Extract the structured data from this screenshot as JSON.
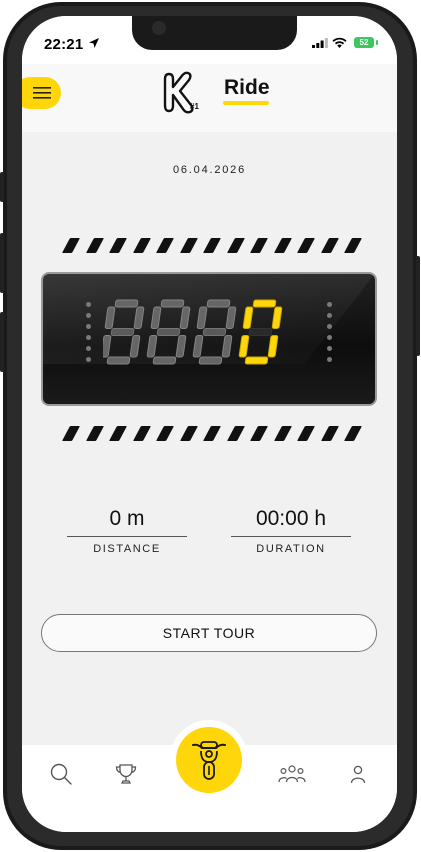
{
  "status_bar": {
    "time": "22:21",
    "battery": "52"
  },
  "header": {
    "title": "Ride"
  },
  "ride": {
    "date": "06.04.2026",
    "odometer_digits": [
      "0",
      "0",
      "0",
      "0"
    ],
    "distance_value": "0 m",
    "distance_label": "DISTANCE",
    "duration_value": "00:00 h",
    "duration_label": "DURATION",
    "start_button": "START TOUR"
  },
  "tabs": [
    "search-icon",
    "trophy-icon",
    "motorcycle-icon",
    "community-icon",
    "profile-icon"
  ],
  "colors": {
    "accent": "#ffd60a",
    "background": "#f1f1f1",
    "display": "#111111",
    "digit_active": "#ffd60a",
    "digit_dim": "#6e6e6e"
  }
}
